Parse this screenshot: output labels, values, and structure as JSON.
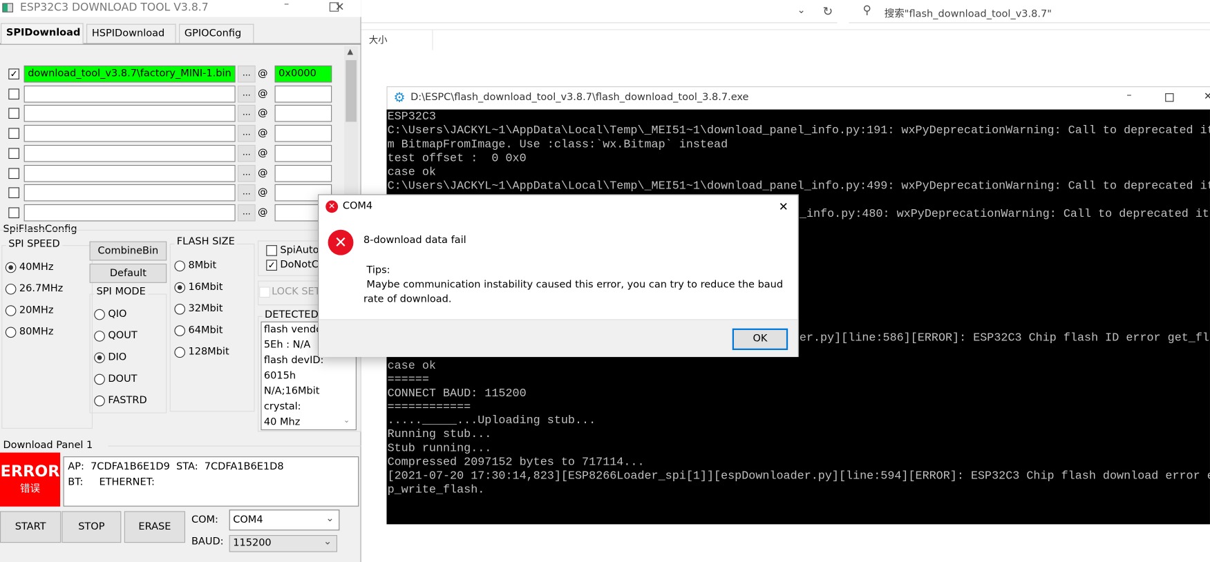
{
  "explorer": {
    "search_text": "搜索\"flash_download_tool_v3.8.7\"",
    "column_size": "大小"
  },
  "tool": {
    "title": "ESP32C3 DOWNLOAD TOOL V3.8.7",
    "tabs": [
      {
        "label": "SPIDownload",
        "active": true
      },
      {
        "label": "HSPIDownload",
        "active": false
      },
      {
        "label": "GPIOConfig",
        "active": false
      }
    ],
    "files": [
      {
        "checked": true,
        "path": "download_tool_v3.8.7\\factory_MINI-1.bin",
        "offset": "0x0000"
      },
      {
        "checked": false,
        "path": "",
        "offset": ""
      },
      {
        "checked": false,
        "path": "",
        "offset": ""
      },
      {
        "checked": false,
        "path": "",
        "offset": ""
      },
      {
        "checked": false,
        "path": "",
        "offset": ""
      },
      {
        "checked": false,
        "path": "",
        "offset": ""
      },
      {
        "checked": false,
        "path": "",
        "offset": ""
      },
      {
        "checked": false,
        "path": "",
        "offset": ""
      }
    ],
    "browse_label": "...",
    "at_label": "@",
    "spi_flash_config_label": "SpiFlashConfig",
    "spi_speed": {
      "label": "SPI SPEED",
      "options": [
        "40MHz",
        "26.7MHz",
        "20MHz",
        "80MHz"
      ],
      "selected": "40MHz"
    },
    "combine_bin_label": "CombineBin",
    "default_label": "Default",
    "spi_mode": {
      "label": "SPI MODE",
      "options": [
        "QIO",
        "QOUT",
        "DIO",
        "DOUT",
        "FASTRD"
      ],
      "selected": "DIO"
    },
    "flash_size": {
      "label": "FLASH SIZE",
      "options": [
        "8Mbit",
        "16Mbit",
        "32Mbit",
        "64Mbit",
        "128Mbit"
      ],
      "selected": "16Mbit"
    },
    "spi_auto": {
      "label": "SpiAuto",
      "checked": false
    },
    "do_not_chg": {
      "label": "DoNotC",
      "checked": true
    },
    "lock_settings": {
      "label": "LOCK SET",
      "checked": false
    },
    "detected": {
      "label": "DETECTED",
      "lines": [
        "flash vendo",
        "5Eh : N/A",
        "flash devID:",
        "6015h",
        "N/A;16Mbit",
        "crystal:",
        "40 Mhz"
      ]
    },
    "download_panel_label": "Download Panel 1",
    "status": {
      "text": "ERROR",
      "subtext": "错误",
      "color": "#ff0000"
    },
    "info_lines": [
      "AP:  7CDFA1B6E1D9  STA:  7CDFA1B6E1D8",
      "BT:     ETHERNET:"
    ],
    "start_label": "START",
    "stop_label": "STOP",
    "erase_label": "ERASE",
    "com_label": "COM:",
    "com_value": "COM4",
    "baud_label": "BAUD:",
    "baud_value": "115200"
  },
  "console": {
    "title": "D:\\ESPC\\flash_download_tool_v3.8.7\\flash_download_tool_3.8.7.exe",
    "lines": [
      "ESP32C3",
      "C:\\Users\\JACKYL~1\\AppData\\Local\\Temp\\_MEI51~1\\download_panel_info.py:191: wxPyDeprecationWarning: Call to deprecated it",
      "m BitmapFromImage. Use :class:`wx.Bitmap` instead",
      "test offset :  0 0x0",
      "case ok",
      "C:\\Users\\JACKYL~1\\AppData\\Local\\Temp\\_MEI51~1\\download_panel_info.py:499: wxPyDeprecationWarning: Call to deprecated it",
      "",
      "_info.py:480: wxPyDeprecationWarning: Call to deprecated it",
      "",
      "",
      "",
      "",
      "",
      "",
      "",
      "",
      "er.py][line:586][ERROR]: ESP32C3 Chip flash ID error get_fla",
      "",
      "case ok",
      "======",
      "CONNECT BAUD: 115200",
      "============",
      "....._____...Uploading stub...",
      "Running stub...",
      "Stub running...",
      "Compressed 2097152 bytes to 717114...",
      "[2021-07-20 17:30:14,823][ESP8266Loader_spi[1]][espDownloader.py][line:594][ERROR]: ESP32C3 Chip flash download error e",
      "p_write_flash."
    ]
  },
  "dialog": {
    "title": "COM4",
    "message": "8-download data fail",
    "tips_label": "Tips:",
    "tips_text": "Maybe communication instability caused this error, you can try to reduce the baud rate of download.",
    "ok_label": "OK"
  }
}
